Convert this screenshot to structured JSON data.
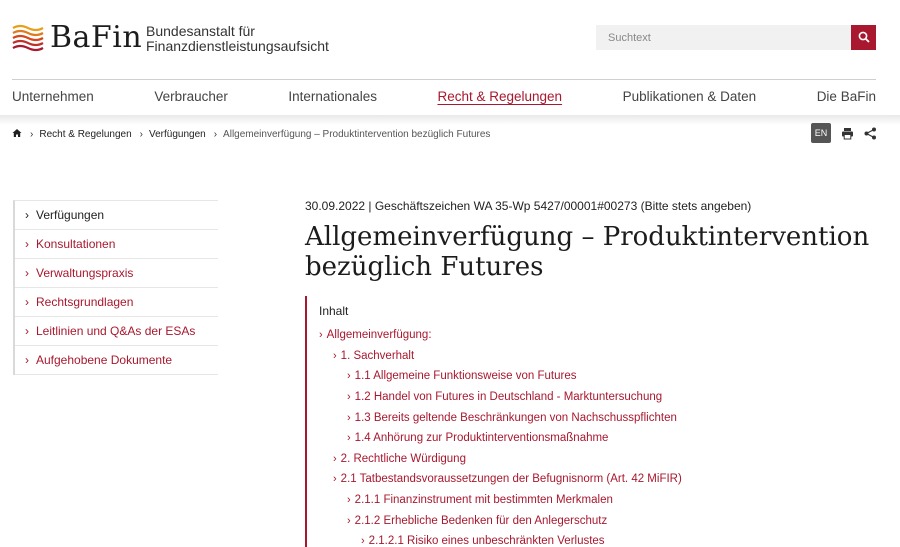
{
  "header": {
    "logo_word": "BaFin",
    "logo_sub_line1": "Bundesanstalt für",
    "logo_sub_line2": "Finanzdienstleistungsaufsicht",
    "search_placeholder": "Suchtext",
    "search_icon": "search-icon",
    "accent_color": "#a8182e"
  },
  "nav": {
    "items": [
      {
        "label": "Unternehmen"
      },
      {
        "label": "Verbraucher"
      },
      {
        "label": "Internationales"
      },
      {
        "label": "Recht & Regelungen",
        "active": true
      },
      {
        "label": "Publikationen & Daten"
      },
      {
        "label": "Die BaFin"
      }
    ]
  },
  "breadcrumb": {
    "home_icon": "home-icon",
    "items": [
      "Recht & Regelungen",
      "Verfügungen"
    ],
    "current": "Allgemeinverfügung – Produktintervention bezüglich Futures"
  },
  "tools": {
    "language": "EN",
    "print_icon": "print-icon",
    "share_icon": "share-icon"
  },
  "sidebar": {
    "items": [
      {
        "label": "Verfügungen"
      },
      {
        "label": "Konsultationen"
      },
      {
        "label": "Verwaltungspraxis"
      },
      {
        "label": "Rechtsgrundlagen"
      },
      {
        "label": "Leitlinien und Q&As der ESAs"
      },
      {
        "label": "Aufgehobene Dokumente"
      }
    ]
  },
  "article": {
    "meta": "30.09.2022 | Geschäftszeichen WA 35-Wp 5427/00001#00273 (Bitte stets angeben)",
    "title_line1": "Allgemeinverfügung – Produktintervention",
    "title_line2": "bezüglich Futures"
  },
  "toc": {
    "heading": "Inhalt",
    "items": [
      {
        "label": "Allgemeinverfügung:",
        "level": 0
      },
      {
        "label": "1. Sachverhalt",
        "level": 1
      },
      {
        "label": "1.1 Allgemeine Funktionsweise von Futures",
        "level": 2
      },
      {
        "label": "1.2 Handel von Futures in Deutschland - Marktuntersuchung",
        "level": 2
      },
      {
        "label": "1.3 Bereits geltende Beschränkungen von Nachschusspflichten",
        "level": 2
      },
      {
        "label": "1.4 Anhörung zur Produktinterventionsmaßnahme",
        "level": 2
      },
      {
        "label": "2. Rechtliche Würdigung",
        "level": 1
      },
      {
        "label": "2.1 Tatbestandsvoraussetzungen der Befugnisnorm (Art. 42 MiFIR)",
        "level": 1
      },
      {
        "label": "2.1.1 Finanzinstrument mit bestimmten Merkmalen",
        "level": 2
      },
      {
        "label": "2.1.2 Erhebliche Bedenken für den Anlegerschutz",
        "level": 2
      },
      {
        "label": "2.1.2.1 Risiko eines unbeschränkten Verlustes",
        "level": 3
      }
    ]
  }
}
